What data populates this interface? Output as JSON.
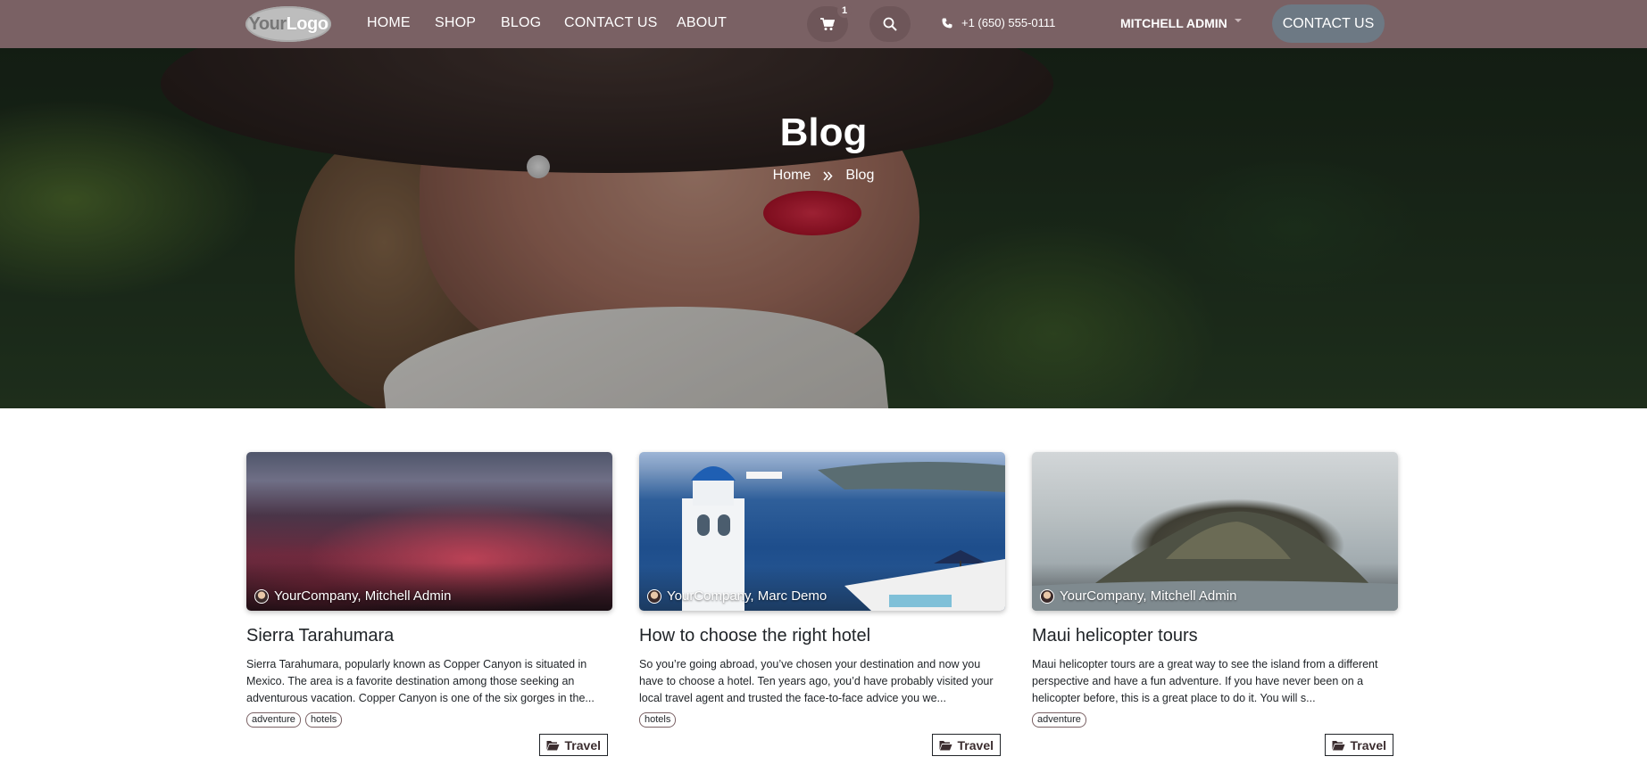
{
  "brand": {
    "logo_your": "Your",
    "logo_logo": "Logo"
  },
  "nav": {
    "links": [
      "HOME",
      "SHOP",
      "BLOG",
      "CONTACT US",
      "ABOUT"
    ],
    "cart_count": "1",
    "phone": "+1 (650) 555-0111",
    "user": "MITCHELL ADMIN",
    "contact_button": "CONTACT US"
  },
  "hero": {
    "title": "Blog",
    "breadcrumb_home": "Home",
    "breadcrumb_current": "Blog"
  },
  "posts": [
    {
      "author": "YourCompany, Mitchell Admin",
      "title": "Sierra Tarahumara",
      "excerpt": "Sierra Tarahumara, popularly known as Copper Canyon is situated in Mexico. The area is a favorite destination among those seeking an adventurous vacation. Copper Canyon is one of the six gorges in the...",
      "tags": [
        "adventure",
        "hotels"
      ],
      "category": "Travel"
    },
    {
      "author": "YourCompany, Marc Demo",
      "title": "How to choose the right hotel",
      "excerpt": "So you’re going abroad, you’ve chosen your destination and now you have to choose a hotel. Ten years ago, you’d have probably visited your local travel agent and trusted the face-to-face advice you we...",
      "tags": [
        "hotels"
      ],
      "category": "Travel"
    },
    {
      "author": "YourCompany, Mitchell Admin",
      "title": "Maui helicopter tours",
      "excerpt": "Maui helicopter tours are a great way to see the island from a different perspective and have a fun adventure. If you have never been on a helicopter before, this is a great place to do it. You will s...",
      "tags": [
        "adventure"
      ],
      "category": "Travel"
    }
  ],
  "icons": {
    "cart": "shopping-cart-icon",
    "search": "search-icon",
    "phone": "phone-icon",
    "breadcrumb_separator": "double-chevron-right-icon",
    "category": "folder-open-icon"
  },
  "colors": {
    "navbar": "#7a6164",
    "contact_button": "#6d7984",
    "tag_border": "#7a6164",
    "text": "#212529"
  }
}
